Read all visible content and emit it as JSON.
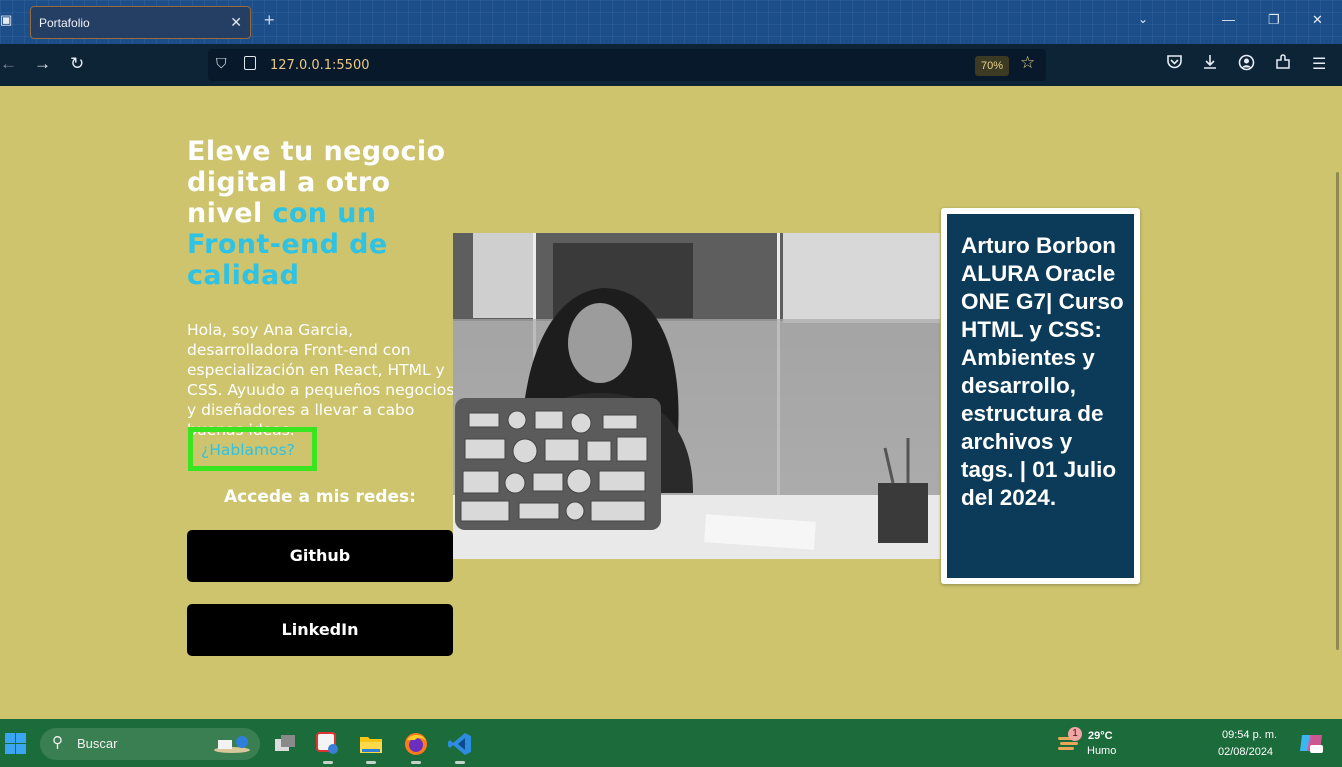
{
  "browser": {
    "tab_title": "Portafolio",
    "url": "127.0.0.1:5500",
    "zoom": "70%"
  },
  "page": {
    "headline_plain": "Eleve tu negocio digital a otro nivel ",
    "headline_accent": "con un Front-end de calidad",
    "intro": "Hola, soy Ana Garcia, desarrolladora Front-end con especialización en React, HTML y CSS. Ayuudo a pequeños negocios y diseñadores a llevar a cabo buenas ideas.",
    "talk_link": "¿Hablamos?",
    "social_title": "Accede a mis redes:",
    "github_button": "Github",
    "linkedin_button": "LinkedIn",
    "card_text": "Arturo Borbon ALURA Oracle ONE G7| Curso HTML y CSS: Ambientes y desarrollo, estructura de archivos y tags. | 01 Julio del 2024."
  },
  "taskbar": {
    "search_placeholder": "Buscar",
    "weather_badge": "1",
    "temperature": "29°C",
    "condition": "Humo",
    "time": "09:54 p. m.",
    "date": "02/08/2024"
  },
  "colors": {
    "page_background": "#cdc46d",
    "accent": "#2ec2e5",
    "card_background": "#0b3b58",
    "highlight_border": "#39e51e",
    "taskbar": "#1b6b3b"
  }
}
